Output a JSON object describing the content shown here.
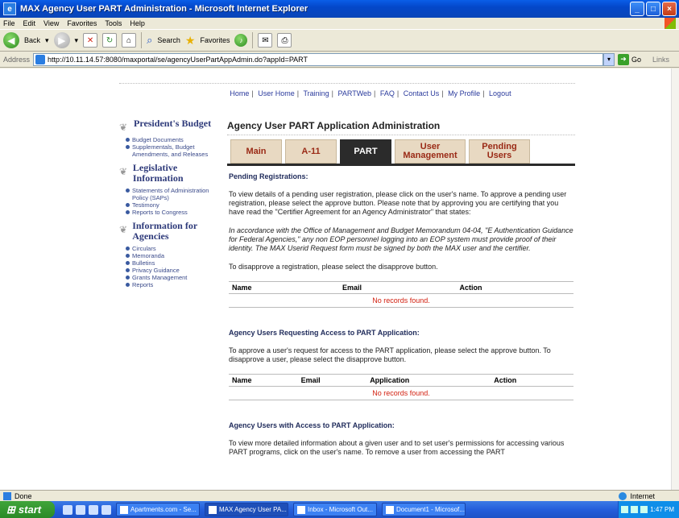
{
  "window": {
    "title": "MAX Agency User PART Administration - Microsoft Internet Explorer",
    "buttons": [
      "_",
      "□",
      "×"
    ]
  },
  "menu": [
    "File",
    "Edit",
    "View",
    "Favorites",
    "Tools",
    "Help"
  ],
  "toolbar": {
    "back": "Back",
    "search": "Search",
    "favorites": "Favorites"
  },
  "address": {
    "label": "Address",
    "url": "http://10.11.14.57:8080/maxportal/se/agencyUserPartAppAdmin.do?appId=PART",
    "go": "Go",
    "links": "Links"
  },
  "topnav": [
    "Home",
    "User Home",
    "Training",
    "PARTWeb",
    "FAQ",
    "Contact Us",
    "My Profile",
    "Logout"
  ],
  "sidebar": {
    "sections": [
      {
        "title": "President's Budget",
        "items": [
          "Budget Documents",
          "Supplementals, Budget Amendments, and Releases"
        ]
      },
      {
        "title": "Legislative Information",
        "items": [
          "Statements of Administration Policy (SAPs)",
          "Testimony",
          "Reports to Congress"
        ]
      },
      {
        "title": "Information for Agencies",
        "items": [
          "Circulars",
          "Memoranda",
          "Bulletins",
          "Privacy Guidance",
          "Grants Management",
          "Reports"
        ]
      }
    ]
  },
  "main": {
    "title": "Agency User PART Application Administration",
    "tabs": [
      "Main",
      "A-11",
      "PART",
      "User Management",
      "Pending Users"
    ],
    "pending_heading": "Pending Registrations:",
    "pending_p1": "To view details of a pending user registration, please click on the user's name. To approve a pending user registration, please select the approve button. Please note that by approving you are certifying that you have read the \"Certifier Agreement for an Agency Administrator\" that states:",
    "pending_p2": "In accordance with the Office of Management and Budget Memorandum 04-04, \"E Authentication Guidance for Federal Agencies,\" any non EOP personnel logging into an EOP system must provide proof of their identity. The MAX Userid Request form must be signed by both the MAX user and the certifier.",
    "pending_p3": "To disapprove a registration, please select the disapprove button.",
    "table1": {
      "headers": [
        "Name",
        "Email",
        "Action"
      ],
      "empty": "No records found."
    },
    "access_heading": "Agency Users Requesting Access to PART Application:",
    "access_p": "To approve a user's request for access to the PART application, please select the approve button. To disapprove a user, please select the disapprove button.",
    "table2": {
      "headers": [
        "Name",
        "Email",
        "Application",
        "Action"
      ],
      "empty": "No records found."
    },
    "with_heading": "Agency Users with Access to PART Application:",
    "with_p": "To view more detailed information about a given user and to set user's permissions for accessing various PART programs, click on the user's name. To remove a user from accessing the PART"
  },
  "status": {
    "left": "Done",
    "zone": "Internet"
  },
  "taskbar": {
    "start": "start",
    "tasks": [
      "Apartments.com - Se...",
      "MAX Agency User PA...",
      "Inbox - Microsoft Out...",
      "Document1 - Microsof..."
    ],
    "clock": "1:47 PM"
  }
}
